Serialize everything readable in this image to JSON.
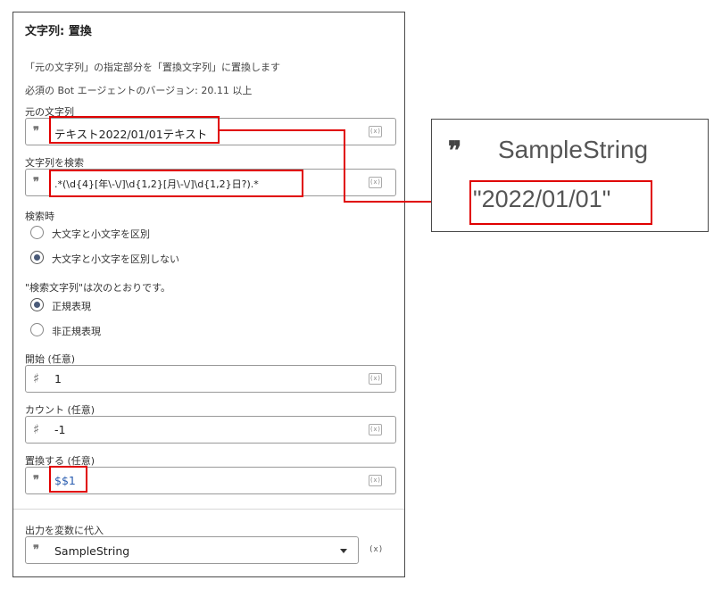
{
  "panel": {
    "title": "文字列: 置換",
    "description": "「元の文字列」の指定部分を「置換文字列」に置換します",
    "requirement": "必須の Bot エージェントのバージョン: 20.11 以上",
    "source": {
      "label": "元の文字列",
      "value": "テキスト2022/01/01テキスト",
      "prefix_icon": "quote-icon"
    },
    "search": {
      "label": "文字列を検索",
      "value": ".*(\\d{4}[年\\-\\/]\\d{1,2}[月\\-\\/]\\d{1,2}日?).*",
      "prefix_icon": "quote-icon"
    },
    "case": {
      "label": "検索時",
      "options": [
        {
          "label": "大文字と小文字を区別",
          "selected": false
        },
        {
          "label": "大文字と小文字を区別しない",
          "selected": true
        }
      ]
    },
    "search_type": {
      "label": "\"検索文字列\"は次のとおりです。",
      "options": [
        {
          "label": "正規表現",
          "selected": true
        },
        {
          "label": "非正規表現",
          "selected": false
        }
      ]
    },
    "start": {
      "label": "開始 (任意)",
      "value": "1",
      "prefix_icon": "hash-icon"
    },
    "count": {
      "label": "カウント (任意)",
      "value": "-1",
      "prefix_icon": "hash-icon"
    },
    "replace": {
      "label": "置換する (任意)",
      "value": "$$1",
      "prefix_icon": "quote-icon"
    },
    "output": {
      "label": "出力を変数に代入",
      "value": "SampleString",
      "prefix_icon": "quote-icon"
    },
    "variable_icon": "(x)",
    "quote_glyph": "❞",
    "hash_glyph": "♯"
  },
  "preview": {
    "variable_name": "SampleString",
    "result": "\"2022/01/01\""
  },
  "colors": {
    "highlight": "#e00000",
    "radio_selected": "#4a5a78",
    "value_blue": "#2a5db0"
  }
}
